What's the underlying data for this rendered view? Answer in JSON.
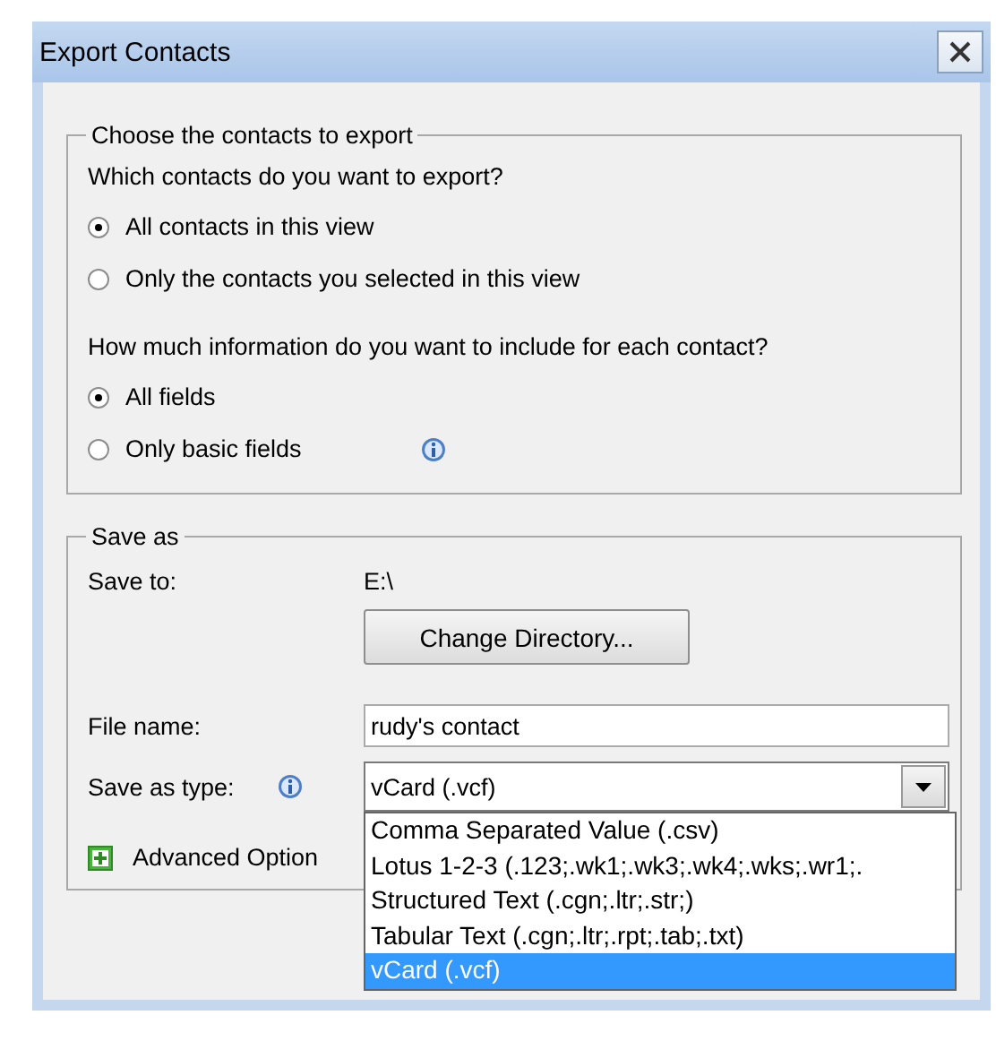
{
  "window": {
    "title": "Export Contacts"
  },
  "contacts_group": {
    "legend": "Choose the contacts to export",
    "question": "Which contacts do you want to export?",
    "options": [
      {
        "label": "All contacts in this view",
        "selected": true
      },
      {
        "label": "Only the contacts you selected in this view",
        "selected": false
      }
    ],
    "info_question": "How much information do you want to include for each contact?",
    "info_options": [
      {
        "label": "All fields",
        "selected": true,
        "info": false
      },
      {
        "label": "Only basic fields",
        "selected": false,
        "info": true
      }
    ]
  },
  "save_group": {
    "legend": "Save as",
    "save_to_label": "Save to:",
    "save_to_value": "E:\\",
    "change_button": "Change Directory...",
    "file_name_label": "File name:",
    "file_name": "rudy's contact",
    "type_label": "Save as type:",
    "type_value": "vCard (.vcf)",
    "type_options": [
      {
        "label": "Comma Separated Value (.csv)",
        "selected": false
      },
      {
        "label": "Lotus 1-2-3 (.123;.wk1;.wk3;.wk4;.wks;.wr1;.",
        "selected": false
      },
      {
        "label": "Structured Text (.cgn;.ltr;.str;)",
        "selected": false
      },
      {
        "label": "Tabular Text (.cgn;.ltr;.rpt;.tab;.txt)",
        "selected": false
      },
      {
        "label": "vCard (.vcf)",
        "selected": true
      }
    ],
    "advanced": {
      "label": "Advanced Option",
      "expanded": false
    }
  }
}
